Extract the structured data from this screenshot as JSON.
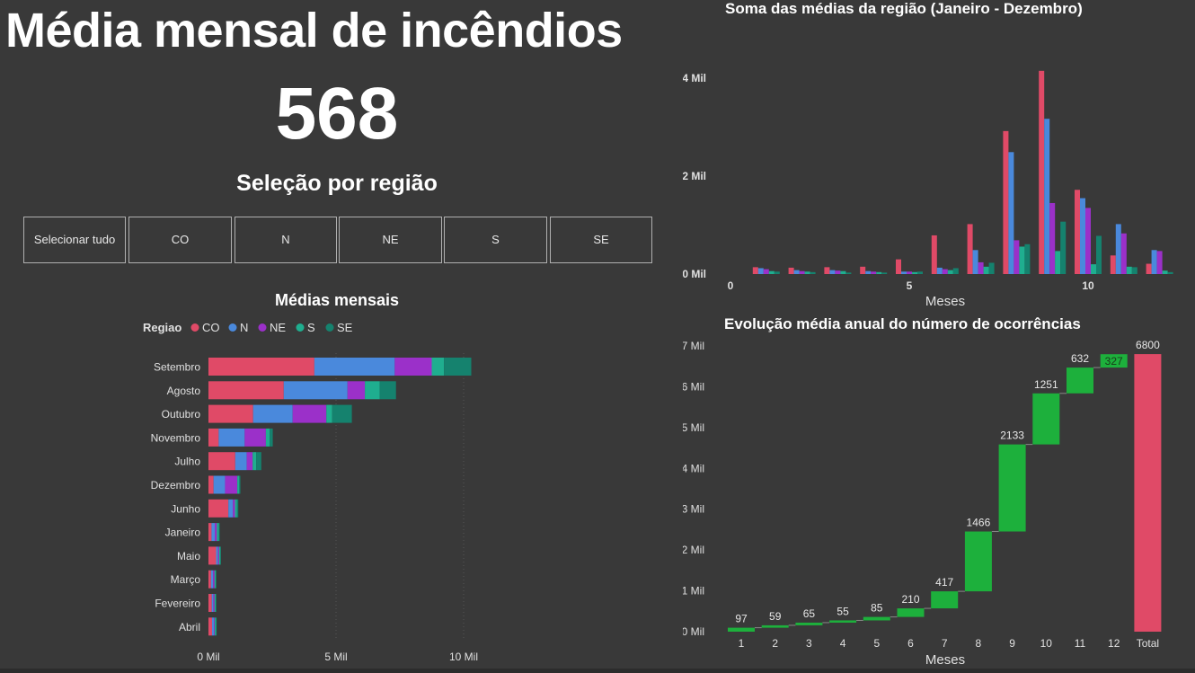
{
  "header": {
    "title": "Média mensal de incêndios",
    "kpi_value": "568",
    "slicer_title": "Seleção por região"
  },
  "slicer": {
    "buttons": [
      "Selecionar tudo",
      "CO",
      "N",
      "NE",
      "S",
      "SE"
    ]
  },
  "colors": {
    "CO": "#e04a67",
    "N": "#4a89dc",
    "NE": "#9b30c9",
    "S": "#1fae8f",
    "SE": "#15826e",
    "increase": "#1db03c",
    "total": "#e04a67",
    "background": "#393939"
  },
  "chart_data": [
    {
      "type": "bar",
      "orientation": "horizontal",
      "stacked": true,
      "title": "Médias mensais",
      "legend_title": "Regiao",
      "legend_position": "top-left",
      "categories": [
        "Setembro",
        "Agosto",
        "Outubro",
        "Novembro",
        "Julho",
        "Dezembro",
        "Junho",
        "Janeiro",
        "Maio",
        "Março",
        "Fevereiro",
        "Abril"
      ],
      "series": [
        {
          "name": "CO",
          "values": [
            4150,
            2950,
            1750,
            400,
            1050,
            200,
            780,
            120,
            300,
            100,
            130,
            140
          ]
        },
        {
          "name": "N",
          "values": [
            3150,
            2500,
            1550,
            1020,
            450,
            450,
            180,
            130,
            80,
            80,
            60,
            80
          ]
        },
        {
          "name": "NE",
          "values": [
            1450,
            680,
            1320,
            830,
            230,
            480,
            80,
            80,
            40,
            60,
            50,
            30
          ]
        },
        {
          "name": "S",
          "values": [
            480,
            580,
            230,
            150,
            140,
            80,
            80,
            80,
            50,
            50,
            50,
            50
          ]
        },
        {
          "name": "SE",
          "values": [
            1070,
            640,
            770,
            120,
            200,
            40,
            50,
            30,
            20,
            20,
            20,
            20
          ]
        }
      ],
      "xticks": [
        "0 Mil",
        "5 Mil",
        "10 Mil"
      ],
      "xlim": [
        0,
        10000
      ],
      "grid": false
    },
    {
      "type": "bar",
      "orientation": "vertical",
      "grouped": true,
      "title": "Soma das médias da região (Janeiro - Dezembro)",
      "xlabel": "Meses",
      "x": [
        1,
        2,
        3,
        4,
        5,
        6,
        7,
        8,
        9,
        10,
        11,
        12
      ],
      "xticks": [
        "0",
        "5",
        "10"
      ],
      "yticks": [
        "0 Mil",
        "2 Mil",
        "4 Mil"
      ],
      "ylim": [
        0,
        4000
      ],
      "series": [
        {
          "name": "CO",
          "values": [
            140,
            130,
            140,
            150,
            300,
            790,
            1020,
            2920,
            4150,
            1720,
            380,
            210
          ]
        },
        {
          "name": "N",
          "values": [
            120,
            80,
            80,
            60,
            50,
            130,
            490,
            2490,
            3170,
            1550,
            1020,
            490
          ]
        },
        {
          "name": "NE",
          "values": [
            100,
            60,
            70,
            50,
            50,
            100,
            240,
            690,
            1450,
            1350,
            830,
            470
          ]
        },
        {
          "name": "S",
          "values": [
            60,
            50,
            60,
            40,
            40,
            80,
            150,
            560,
            470,
            200,
            150,
            70
          ]
        },
        {
          "name": "SE",
          "values": [
            50,
            40,
            30,
            30,
            50,
            120,
            230,
            610,
            1070,
            780,
            140,
            40
          ]
        }
      ],
      "grid": false
    },
    {
      "type": "bar",
      "subtype": "waterfall",
      "title": "Evolução média anual do número de ocorrências",
      "xlabel": "Meses",
      "categories": [
        "1",
        "2",
        "3",
        "4",
        "5",
        "6",
        "7",
        "8",
        "9",
        "10",
        "11",
        "12",
        "Total"
      ],
      "values": [
        97,
        59,
        65,
        55,
        85,
        210,
        417,
        1466,
        2133,
        1251,
        632,
        327,
        6800
      ],
      "labels": [
        "97",
        "59",
        "65",
        "55",
        "85",
        "210",
        "417",
        "1466",
        "2133",
        "1251",
        "632",
        "327",
        "6800"
      ],
      "yticks": [
        "0 Mil",
        "1 Mil",
        "2 Mil",
        "3 Mil",
        "4 Mil",
        "5 Mil",
        "6 Mil",
        "7 Mil"
      ],
      "ylim": [
        0,
        7000
      ],
      "grid": false
    }
  ]
}
